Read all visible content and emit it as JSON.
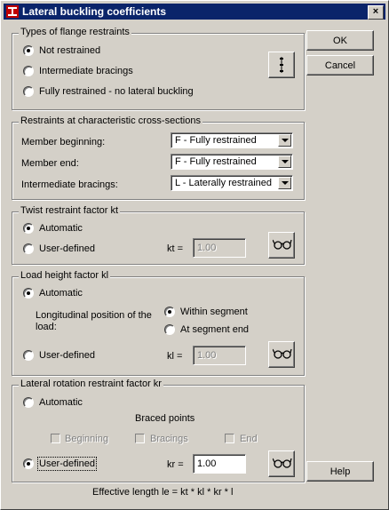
{
  "window": {
    "title": "Lateral buckling coefficients",
    "close_label": "×"
  },
  "buttons": {
    "ok": "OK",
    "cancel": "Cancel",
    "help": "Help"
  },
  "flange": {
    "legend": "Types of flange restraints",
    "options": [
      "Not restrained",
      "Intermediate bracings",
      "Fully restrained - no lateral buckling"
    ],
    "selected": 0
  },
  "restraints": {
    "legend": "Restraints at characteristic cross-sections",
    "rows": [
      {
        "label": "Member beginning:",
        "value": "F - Fully restrained"
      },
      {
        "label": "Member end:",
        "value": "F - Fully restrained"
      },
      {
        "label": "Intermediate bracings:",
        "value": "L - Laterally restrained"
      }
    ]
  },
  "twist": {
    "legend": "Twist restraint factor kt",
    "automatic": "Automatic",
    "user_defined": "User-defined",
    "field_label": "kt =",
    "field_value": "1.00",
    "selected": "automatic"
  },
  "load": {
    "legend": "Load height factor kl",
    "automatic": "Automatic",
    "position_label_1": "Longitudinal position of the",
    "position_label_2": "load:",
    "within": "Within segment",
    "at_end": "At segment end",
    "user_defined": "User-defined",
    "field_label": "kl =",
    "field_value": "1.00",
    "selected": "automatic",
    "position_selected": "within"
  },
  "rotation": {
    "legend": "Lateral rotation restraint factor kr",
    "automatic": "Automatic",
    "braced_points": "Braced points",
    "beginning": "Beginning",
    "bracings": "Bracings",
    "end": "End",
    "user_defined": "User-defined",
    "field_label": "kr =",
    "field_value": "1.00",
    "selected": "user_defined"
  },
  "footer": {
    "formula": "Effective length le = kt * kl * kr * l"
  },
  "icons": {
    "app": "beam-app-icon",
    "restraint": "restraint-diagram-icon",
    "view": "glasses-icon"
  },
  "colors": {
    "titlebar": "#0a246a",
    "face": "#d4d0c8"
  }
}
